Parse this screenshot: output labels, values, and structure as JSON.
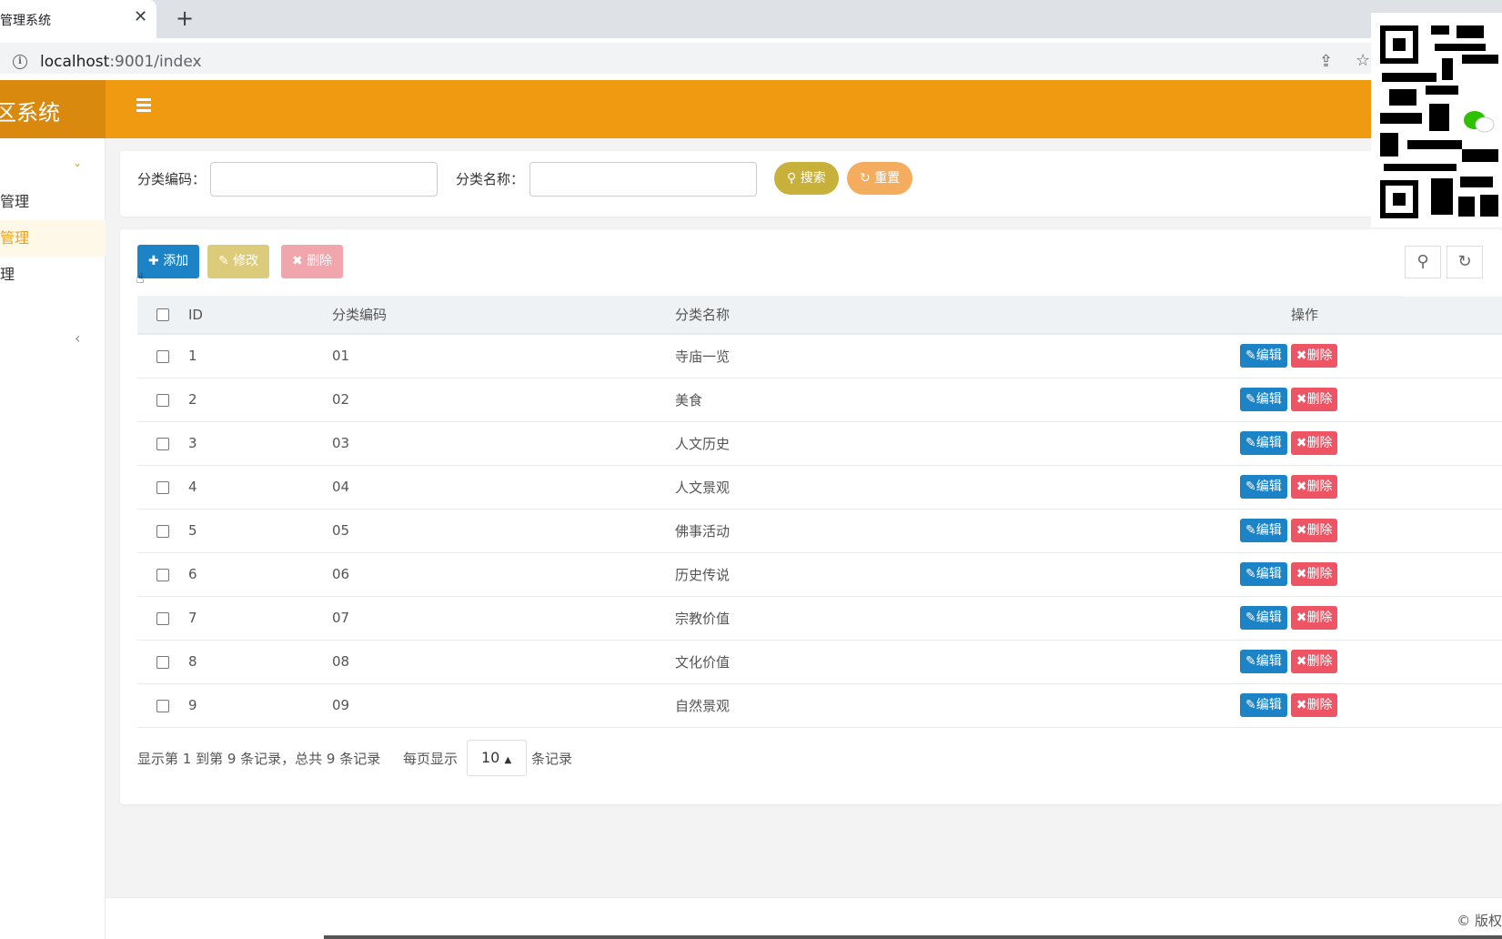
{
  "browser": {
    "tab_title": "管理系统",
    "close_glyph": "✕",
    "new_tab_glyph": "+",
    "url": "localhost:9001/index",
    "url_host": "localhost",
    "url_rest": ":9001/index"
  },
  "header": {
    "logo": "景区系统",
    "logo_visible": "区系统"
  },
  "sidebar": {
    "items": [
      {
        "label": "管理"
      },
      {
        "label": "管理"
      },
      {
        "label": "理"
      }
    ]
  },
  "search": {
    "code_label": "分类编码：",
    "name_label": "分类名称：",
    "search_button": "搜索",
    "reset_button": "重置"
  },
  "toolbar": {
    "add": "添加",
    "edit": "修改",
    "delete": "删除"
  },
  "table": {
    "headers": {
      "id": "ID",
      "code": "分类编码",
      "name": "分类名称",
      "ops": "操作"
    },
    "rows": [
      {
        "id": "1",
        "code": "01",
        "name": "寺庙一览"
      },
      {
        "id": "2",
        "code": "02",
        "name": "美食"
      },
      {
        "id": "3",
        "code": "03",
        "name": "人文历史"
      },
      {
        "id": "4",
        "code": "04",
        "name": "人文景观"
      },
      {
        "id": "5",
        "code": "05",
        "name": "佛事活动"
      },
      {
        "id": "6",
        "code": "06",
        "name": "历史传说"
      },
      {
        "id": "7",
        "code": "07",
        "name": "宗教价值"
      },
      {
        "id": "8",
        "code": "08",
        "name": "文化价值"
      },
      {
        "id": "9",
        "code": "09",
        "name": "自然景观"
      }
    ],
    "row_edit_label": "编辑",
    "row_delete_label": "删除"
  },
  "pager": {
    "summary": "显示第 1 到第 9 条记录，总共 9 条记录",
    "per_page_prefix": "每页显示",
    "page_size": "10",
    "per_page_suffix": "条记录"
  },
  "footer": {
    "copyright": "© 版权"
  },
  "colors": {
    "header": "#f09a12",
    "logo_bg": "#d98a0e",
    "primary": "#1c84c6",
    "danger": "#ed5565",
    "search_btn": "#c7b13a",
    "reset_btn": "#f4ad5f"
  }
}
